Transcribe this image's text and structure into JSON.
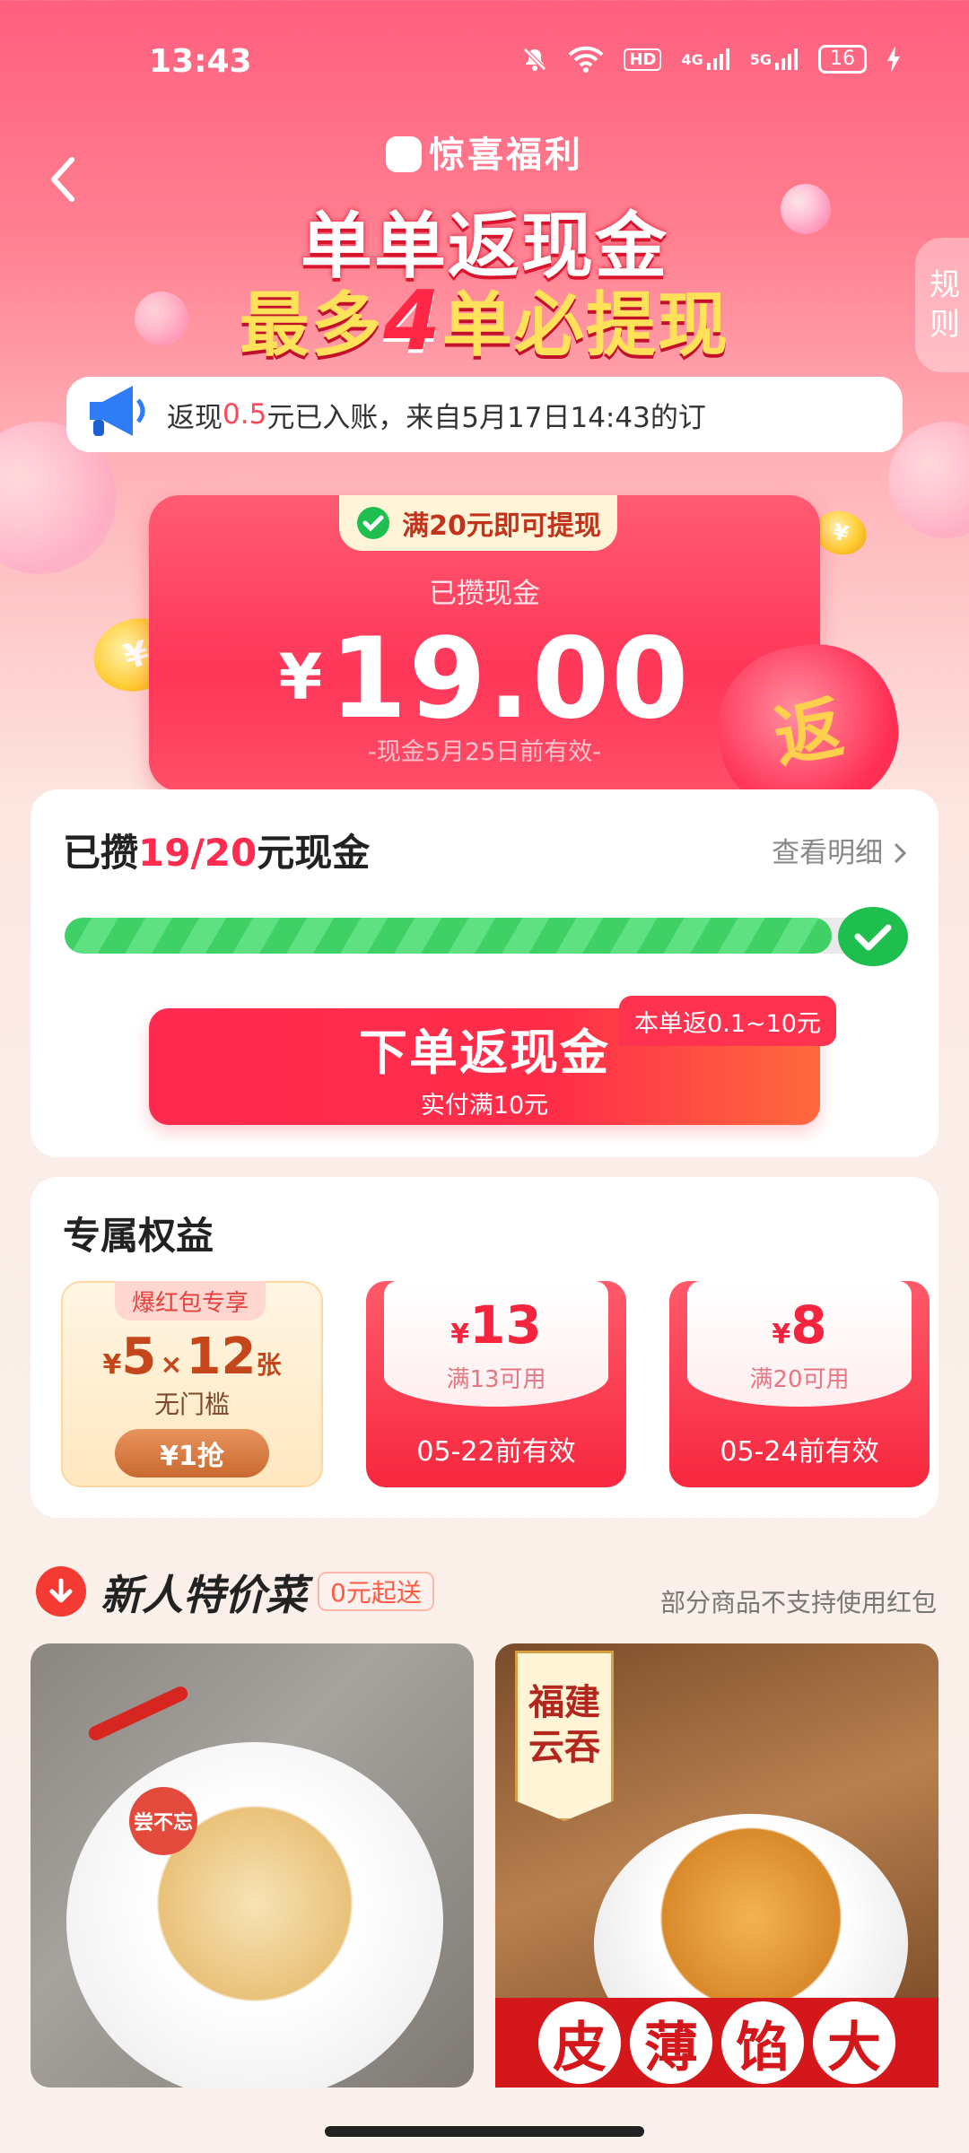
{
  "status_bar": {
    "time": "13:43",
    "hd": "HD",
    "net1": "4G",
    "net2": "5G",
    "battery": "16"
  },
  "header": {
    "brand": "惊喜福利",
    "hero_line1": "单单返现金",
    "hero_line2_pre": "最多",
    "hero_line2_num": "4",
    "hero_line2_post": "单必提现",
    "rules_label": "规则"
  },
  "notice": {
    "pre": "返现",
    "amount": "0.5",
    "post": "元已入账，来自5月17日14:43的订"
  },
  "cash_card": {
    "tag": "满20元即可提现",
    "label": "已攒现金",
    "currency": "¥",
    "amount": "19.00",
    "expiry": "-现金5月25日前有效-",
    "bag_text": "返",
    "coin_symbol": "¥"
  },
  "progress": {
    "title_pre": "已攒",
    "title_value": "19/20",
    "title_post": "元现金",
    "detail_link": "查看明细",
    "fraction": 0.95,
    "order_button_title": "下单返现金",
    "order_button_sub": "实付满10元",
    "order_badge": "本单返0.1~10元"
  },
  "benefits": {
    "title": "专属权益",
    "first": {
      "tag": "爆红包专享",
      "currency": "¥",
      "value": "5",
      "times": "×",
      "count": "12",
      "unit": "张",
      "sub": "无门槛",
      "button": "¥1抢"
    },
    "coupons": [
      {
        "currency": "¥",
        "value": "13",
        "condition": "满13可用",
        "expiry": "05-22前有效"
      },
      {
        "currency": "¥",
        "value": "8",
        "condition": "满20可用",
        "expiry": "05-24前有效"
      }
    ]
  },
  "section": {
    "title": "新人特价菜",
    "tag": "0元起送",
    "note": "部分商品不支持使用红包"
  },
  "products": [
    {
      "stamp": "尝不忘"
    },
    {
      "badge_stars": "★★★",
      "badge": "福建云吞",
      "banner_chars": [
        "皮",
        "薄",
        "馅",
        "大"
      ]
    }
  ],
  "colors": {
    "accent": "#ff2c4f",
    "progress_green": "#3fd166",
    "coupon_red": "#f7273f"
  },
  "icons": [
    "back-icon",
    "mute-icon",
    "wifi-icon",
    "signal-icon",
    "battery-icon",
    "charging-icon",
    "megaphone-icon",
    "check-icon",
    "chevron-right-icon",
    "brand-bag-icon",
    "section-arrow-icon"
  ]
}
